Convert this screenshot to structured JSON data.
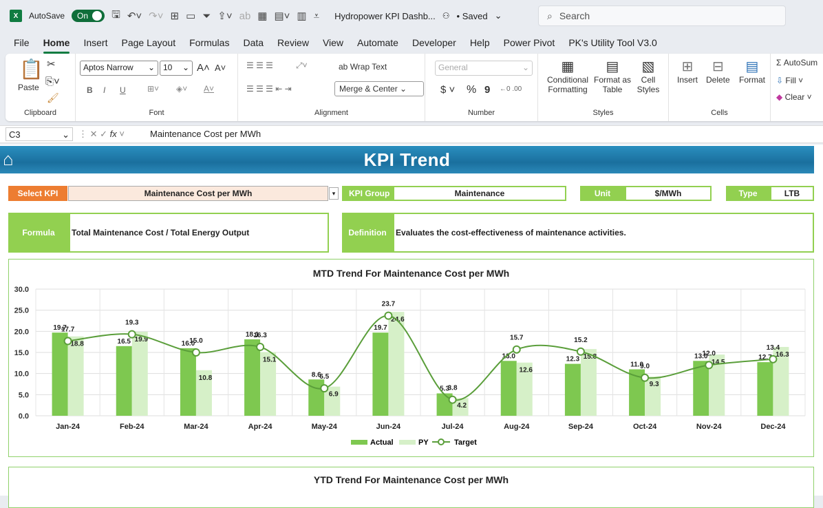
{
  "titlebar": {
    "autosave_label": "AutoSave",
    "autosave_state": "On",
    "doc_title": "Hydropower KPI Dashb...",
    "saved": "• Saved",
    "search_placeholder": "Search"
  },
  "tabs": [
    "File",
    "Home",
    "Insert",
    "Page Layout",
    "Formulas",
    "Data",
    "Review",
    "View",
    "Automate",
    "Developer",
    "Help",
    "Power Pivot",
    "PK's Utility Tool V3.0"
  ],
  "active_tab": "Home",
  "ribbon": {
    "clipboard": {
      "paste": "Paste",
      "label": "Clipboard"
    },
    "font": {
      "name": "Aptos Narrow",
      "size": "10",
      "label": "Font",
      "bold": "B",
      "italic": "I",
      "underline": "U"
    },
    "alignment": {
      "wrap": "Wrap Text",
      "merge": "Merge & Center",
      "label": "Alignment"
    },
    "number": {
      "format": "General",
      "currency": "$",
      "percent": "%",
      "comma": "9",
      "label": "Number"
    },
    "styles": {
      "conditional": "Conditional Formatting",
      "format_table": "Format as Table",
      "cell_styles": "Cell Styles",
      "label": "Styles"
    },
    "cells": {
      "insert": "Insert",
      "delete": "Delete",
      "format": "Format",
      "label": "Cells"
    },
    "editing": {
      "autosum": "AutoSum",
      "fill": "Fill",
      "clear": "Clear"
    }
  },
  "formula_bar": {
    "name_box": "C3",
    "fx": "fx",
    "content": "Maintenance Cost per MWh"
  },
  "dashboard": {
    "title": "KPI Trend",
    "select_kpi_label": "Select KPI",
    "select_kpi_value": "Maintenance Cost per MWh",
    "kpi_group_label": "KPI Group",
    "kpi_group_value": "Maintenance",
    "unit_label": "Unit",
    "unit_value": "$/MWh",
    "type_label": "Type",
    "type_value": "LTB",
    "formula_label": "Formula",
    "formula_value": "Total Maintenance Cost / Total Energy Output",
    "definition_label": "Definition",
    "definition_value": "Evaluates the cost-effectiveness of maintenance activities.",
    "ytd_title": "YTD Trend For Maintenance Cost per MWh",
    "colors": {
      "orange": "#ed7d31",
      "green": "#92d050",
      "actual": "#7ec850",
      "py": "#d6f0c8",
      "target": "#5a9e3a"
    }
  },
  "chart_data": {
    "type": "bar",
    "title": "MTD Trend For Maintenance Cost per MWh",
    "categories": [
      "Jan-24",
      "Feb-24",
      "Mar-24",
      "Apr-24",
      "May-24",
      "Jun-24",
      "Jul-24",
      "Aug-24",
      "Sep-24",
      "Oct-24",
      "Nov-24",
      "Dec-24"
    ],
    "series": [
      {
        "name": "Actual",
        "type": "bar",
        "values": [
          19.7,
          16.5,
          16.0,
          18.1,
          8.6,
          19.7,
          5.3,
          13.0,
          12.3,
          11.0,
          13.0,
          12.7
        ]
      },
      {
        "name": "PY",
        "type": "bar",
        "values": [
          18.8,
          19.9,
          10.8,
          15.1,
          6.9,
          24.6,
          4.2,
          12.6,
          15.8,
          9.3,
          14.5,
          16.3
        ]
      },
      {
        "name": "Target",
        "type": "line",
        "values": [
          17.7,
          19.3,
          15.0,
          16.3,
          6.5,
          23.7,
          3.8,
          15.7,
          15.2,
          9.0,
          12.0,
          13.4
        ]
      }
    ],
    "yticks": [
      "0.0",
      "5.0",
      "10.0",
      "15.0",
      "20.0",
      "25.0",
      "30.0"
    ],
    "ylim": [
      0,
      30
    ],
    "grid": true,
    "legend": "bottom"
  }
}
